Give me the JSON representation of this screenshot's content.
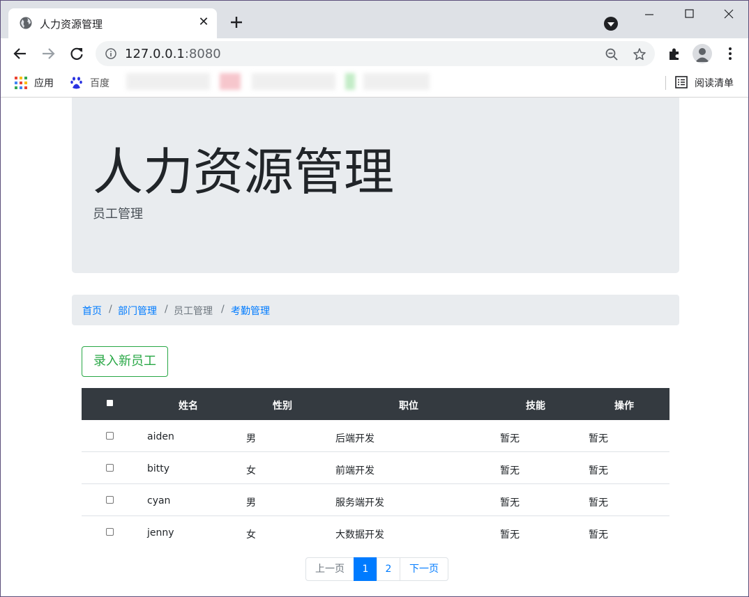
{
  "browser": {
    "tab_title": "人力资源管理",
    "tab_close": "✕",
    "url_host": "127.0.0.1",
    "url_port": ":8080",
    "bookmarks": {
      "apps_label": "应用",
      "baidu_label": "百度",
      "reading_list_label": "阅读清单"
    }
  },
  "page": {
    "title": "人力资源管理",
    "subtitle": "员工管理",
    "breadcrumb": {
      "home": "首页",
      "dept": "部门管理",
      "staff": "员工管理",
      "attendance": "考勤管理",
      "sep": "/"
    },
    "add_button": "录入新员工",
    "table": {
      "headers": {
        "name": "姓名",
        "gender": "性别",
        "position": "职位",
        "skills": "技能",
        "actions": "操作"
      },
      "rows": [
        {
          "name": "aiden",
          "gender": "男",
          "position": "后端开发",
          "skills": "暂无",
          "actions": "暂无"
        },
        {
          "name": "bitty",
          "gender": "女",
          "position": "前端开发",
          "skills": "暂无",
          "actions": "暂无"
        },
        {
          "name": "cyan",
          "gender": "男",
          "position": "服务端开发",
          "skills": "暂无",
          "actions": "暂无"
        },
        {
          "name": "jenny",
          "gender": "女",
          "position": "大数据开发",
          "skills": "暂无",
          "actions": "暂无"
        }
      ]
    },
    "pagination": {
      "prev": "上一页",
      "page1": "1",
      "page2": "2",
      "next": "下一页"
    }
  },
  "colors": {
    "primary": "#007bff",
    "success": "#28a745",
    "dark": "#343a40",
    "jumbotron": "#e9ecef"
  }
}
